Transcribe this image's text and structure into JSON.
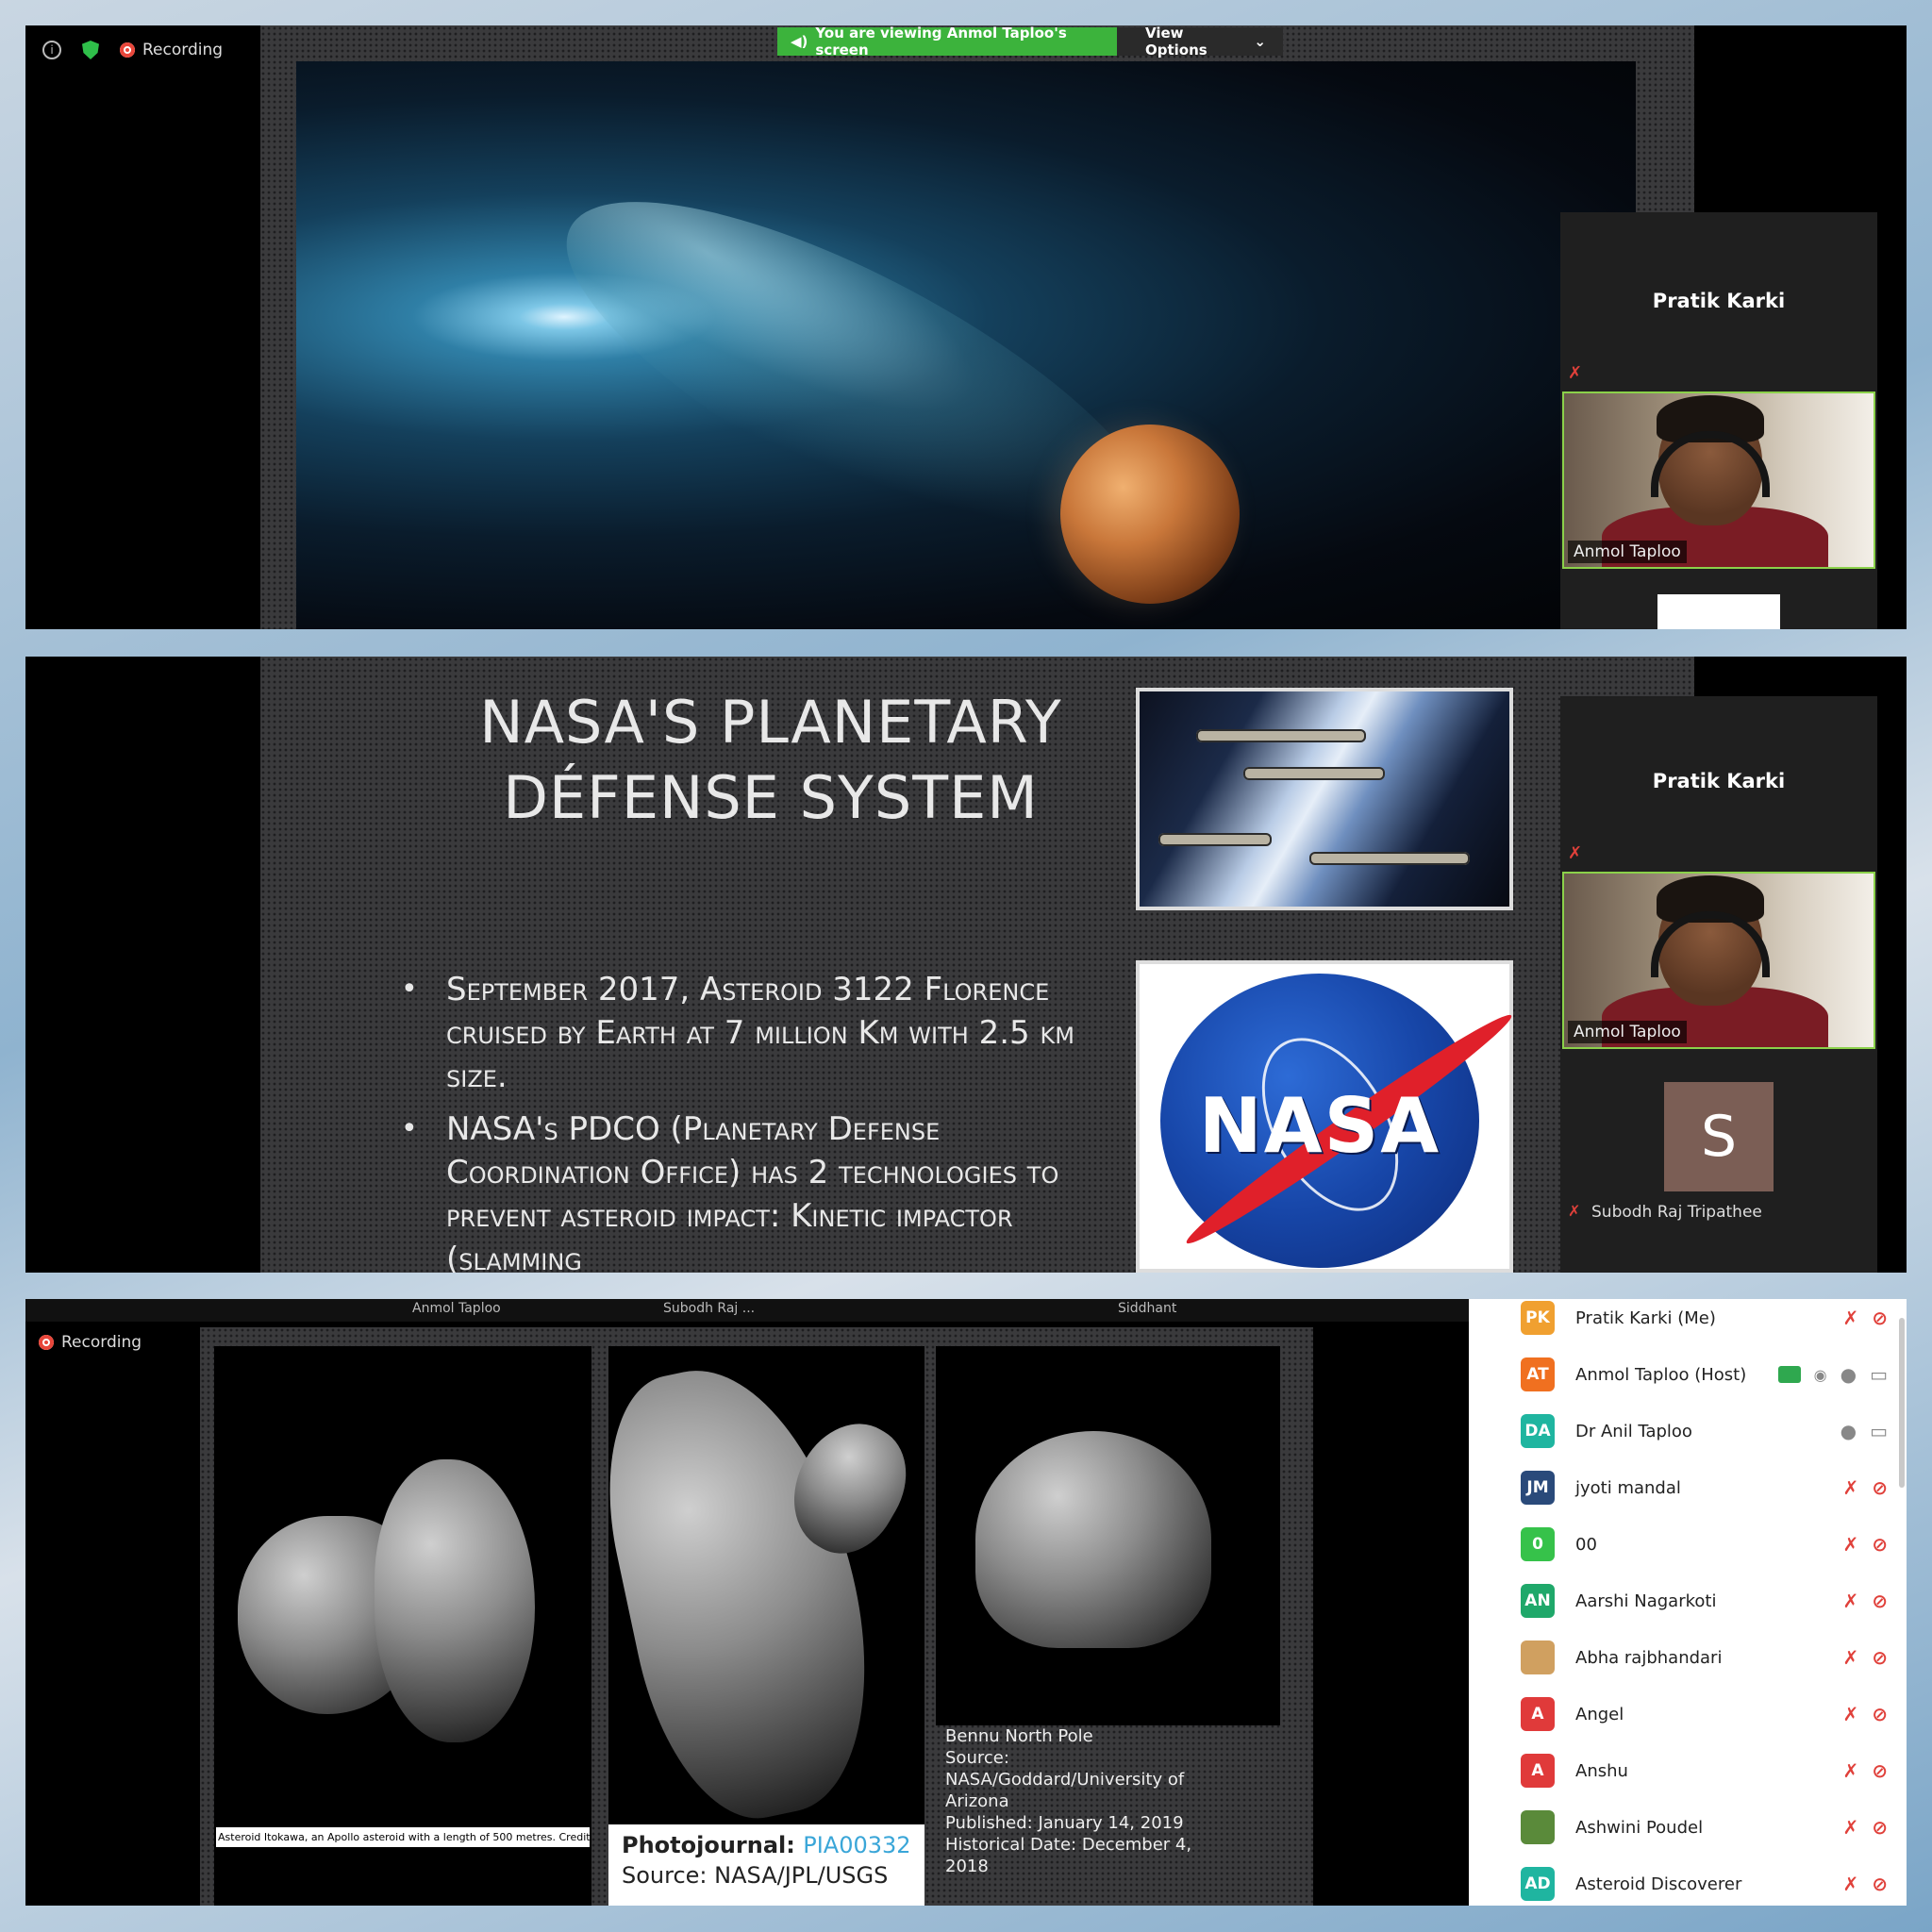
{
  "panel1": {
    "status": {
      "recording_label": "Recording"
    },
    "banner": {
      "viewing_text": "You are viewing Anmol Taploo's screen",
      "view_options_label": "View Options"
    },
    "side": {
      "speaker_name": "Pratik Karki",
      "video_name": "Anmol Taploo"
    }
  },
  "panel2": {
    "slide": {
      "title_line1": "NASA'S PLANETARY",
      "title_line2": "DÉFENSE SYSTEM",
      "bullets": [
        "September 2017, Asteroid 3122 Florence cruised by Earth at 7 million Km with 2.5 km size.",
        "NASA's PDCO (Planetary Defense Coordination Office) has 2 technologies to prevent asteroid impact: Kinetic impactor (slamming"
      ],
      "logo_text": "NASA"
    },
    "side": {
      "speaker_name": "Pratik Karki",
      "video_name": "Anmol Taploo",
      "avatar_letter": "S",
      "avatar_name": "Subodh Raj Tripathee"
    }
  },
  "panel3": {
    "strip": {
      "name1": "Anmol Taploo",
      "name2": "Subodh Raj ...",
      "name3": "Siddhant"
    },
    "status": {
      "recording_label": "Recording"
    },
    "captions": {
      "itokawa": "Asteroid Itokawa, an Apollo asteroid with a length of 500 metres. Credit: JAXA",
      "pj_label": "Photojournal:",
      "pj_link": "PIA00332",
      "pj_source": "Source: NASA/JPL/USGS",
      "bennu": [
        "Bennu North Pole",
        "Source:",
        "NASA/Goddard/University of",
        "Arizona",
        "Published: January 14, 2019",
        "Historical Date: December 4,",
        "2018"
      ]
    },
    "participants": [
      {
        "initials": "PK",
        "name": "Pratik Karki (Me)",
        "color": "#f0a030",
        "mic": "off",
        "cam": "off"
      },
      {
        "initials": "AT",
        "name": "Anmol Taploo (Host)",
        "color": "#f07020",
        "mic": "on",
        "cam": "on",
        "sharing": true
      },
      {
        "initials": "DA",
        "name": "Dr Anil Taploo",
        "color": "#1fb5a0",
        "mic": "on",
        "cam": "on"
      },
      {
        "initials": "JM",
        "name": "jyoti mandal",
        "color": "#2a4a7a",
        "mic": "off",
        "cam": "off"
      },
      {
        "initials": "0",
        "name": "00",
        "color": "#36c24a",
        "mic": "off",
        "cam": "off"
      },
      {
        "initials": "AN",
        "name": "Aarshi Nagarkoti",
        "color": "#1fa86a",
        "mic": "off",
        "cam": "off"
      },
      {
        "initials": "",
        "name": "Abha rajbhandari",
        "color": "#d0a060",
        "mic": "off",
        "cam": "off"
      },
      {
        "initials": "A",
        "name": "Angel",
        "color": "#e03a3a",
        "mic": "off",
        "cam": "off"
      },
      {
        "initials": "A",
        "name": "Anshu",
        "color": "#e03a3a",
        "mic": "off",
        "cam": "off"
      },
      {
        "initials": "",
        "name": "Ashwini Poudel",
        "color": "#5a8a3a",
        "mic": "off",
        "cam": "off"
      },
      {
        "initials": "AD",
        "name": "Asteroid Discoverer",
        "color": "#1fb5a0",
        "mic": "off",
        "cam": "off"
      }
    ]
  }
}
